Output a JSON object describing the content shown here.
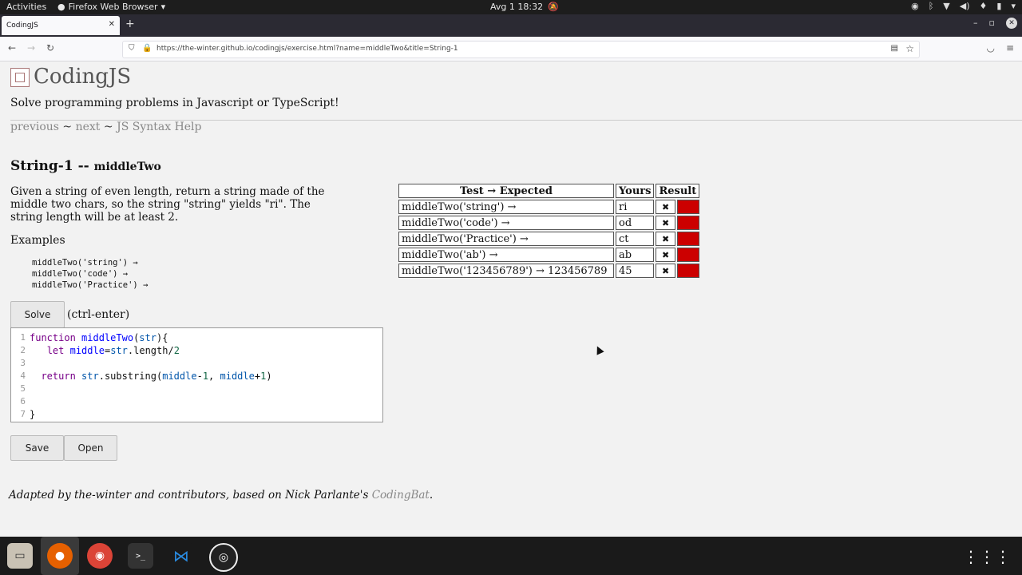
{
  "system": {
    "activities": "Activities",
    "app_name": "Firefox Web Browser",
    "clock": "Avg 1  18:32"
  },
  "browser": {
    "tab_title": "CodingJS",
    "url_host": "https://the-winter.github.io",
    "url_path": "/codingjs/exercise.html?name=middleTwo&title=String-1"
  },
  "site": {
    "brand": "CodingJS",
    "tagline": "Solve programming problems in Javascript or TypeScript!",
    "nav": {
      "previous": "previous",
      "sep1": "~",
      "next": "next",
      "sep2": "~",
      "help": "JS Syntax Help"
    }
  },
  "exercise": {
    "heading": "String-1 --",
    "name": "middleTwo",
    "description": "Given a string of even length, return a string made of the middle two chars, so the string \"string\" yields \"ri\". The string length will be at least 2.",
    "examples_label": "Examples",
    "examples": [
      "middleTwo('string') →",
      "middleTwo('code') →",
      "middleTwo('Practice') →"
    ],
    "solve_label": "Solve",
    "solve_hint": "(ctrl-enter)",
    "save_label": "Save",
    "open_label": "Open"
  },
  "editor": {
    "line_numbers": [
      "1",
      "2",
      "3",
      "4",
      "5",
      "6",
      "7"
    ]
  },
  "results": {
    "headers": [
      "Test → Expected",
      "Yours",
      "Result"
    ],
    "rows": [
      {
        "test": "middleTwo('string') →",
        "yours": "ri",
        "mark": "✖"
      },
      {
        "test": "middleTwo('code') →",
        "yours": "od",
        "mark": "✖"
      },
      {
        "test": "middleTwo('Practice') →",
        "yours": "ct",
        "mark": "✖"
      },
      {
        "test": "middleTwo('ab') →",
        "yours": "ab",
        "mark": "✖"
      },
      {
        "test": "middleTwo('123456789') → 123456789",
        "yours": "45",
        "mark": "✖"
      }
    ],
    "fail_color": "#cc0000"
  },
  "footer": {
    "text": "Adapted by the-winter and contributors, based on Nick Parlante's ",
    "link": "CodingBat",
    "end": "."
  }
}
